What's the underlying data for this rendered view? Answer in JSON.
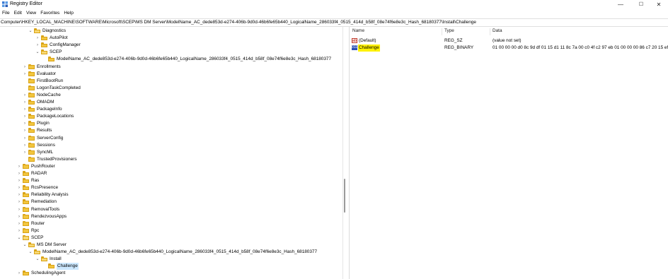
{
  "window": {
    "title": "Registry Editor"
  },
  "window_controls": {
    "minimize": "—",
    "maximize": "☐",
    "close": "✕"
  },
  "menu": [
    "File",
    "Edit",
    "View",
    "Favorites",
    "Help"
  ],
  "address": "Computer\\HKEY_LOCAL_MACHINE\\SOFTWARE\\Microsoft\\SCEP\\MS DM Server\\ModelName_AC_dede853d-e274-406b-9d0d-46b6fe65b440_LogicalName_286033f4_0515_414d_b58f_08e74f6e8e3c_Hash_68180377\\Install\\Challenge",
  "tree": [
    {
      "label": "Diagnostics",
      "expanded": true
    },
    {
      "label": "AutoPilot",
      "expanded": false
    },
    {
      "label": "ConfigManager",
      "expanded": false
    },
    {
      "label": "SCEP",
      "expanded": true
    },
    {
      "label": "ModelName_AC_dede853d-e274-406b-9d0d-46b6fe65b440_LogicalName_286033f4_0515_414d_b58f_08e74f6e8e3c_Hash_68180377",
      "expanded": null
    },
    {
      "label": "Enrollments",
      "expanded": false
    },
    {
      "label": "Evaluator",
      "expanded": false
    },
    {
      "label": "FirstBootRun",
      "expanded": null
    },
    {
      "label": "LogonTaskCompleted",
      "expanded": null
    },
    {
      "label": "NodeCache",
      "expanded": false
    },
    {
      "label": "OMADM",
      "expanded": false
    },
    {
      "label": "PackageInfo",
      "expanded": false
    },
    {
      "label": "PackageLocations",
      "expanded": false
    },
    {
      "label": "Plugin",
      "expanded": false
    },
    {
      "label": "Results",
      "expanded": false
    },
    {
      "label": "ServerConfig",
      "expanded": false
    },
    {
      "label": "Sessions",
      "expanded": false
    },
    {
      "label": "SyncML",
      "expanded": false
    },
    {
      "label": "TrustedProvisioners",
      "expanded": null
    },
    {
      "label": "PushRouter",
      "expanded": false
    },
    {
      "label": "RADAR",
      "expanded": false
    },
    {
      "label": "Ras",
      "expanded": false
    },
    {
      "label": "RcsPresence",
      "expanded": false
    },
    {
      "label": "Reliability Analysis",
      "expanded": false
    },
    {
      "label": "Remediation",
      "expanded": false
    },
    {
      "label": "RemovalTools",
      "expanded": false
    },
    {
      "label": "RendezvousApps",
      "expanded": false
    },
    {
      "label": "Router",
      "expanded": false
    },
    {
      "label": "Rpc",
      "expanded": false
    },
    {
      "label": "SCEP",
      "expanded": true
    },
    {
      "label": "MS DM Server",
      "expanded": true
    },
    {
      "label": "ModelName_AC_dede853d-e274-406b-9d0d-46b6fe65b440_LogicalName_286033f4_0515_414d_b58f_08e74f6e8e3c_Hash_68180377",
      "expanded": true
    },
    {
      "label": "Install",
      "expanded": true
    },
    {
      "label": "Challenge",
      "expanded": null,
      "selected": true
    },
    {
      "label": "SchedulingAgent",
      "expanded": false
    }
  ],
  "columns": {
    "name": "Name",
    "type": "Type",
    "data": "Data"
  },
  "values": [
    {
      "name": "(Default)",
      "type": "REG_SZ",
      "data": "(value not set)",
      "icon": "string-value-icon",
      "icon_text": "ab"
    },
    {
      "name": "Challenge",
      "type": "REG_BINARY",
      "data": "01 00 00 00 d0 8c 9d df 01 15 d1 11 8c 7a 00 c0 4f c2 97 eb 01 00 00 00 86 c7 20 15 ef c",
      "icon": "binary-value-icon",
      "icon_text": "011",
      "highlighted": true
    }
  ],
  "colors": {
    "folder": "#f2c63f",
    "selection": "#cce8ff",
    "highlight": "#fff200"
  }
}
